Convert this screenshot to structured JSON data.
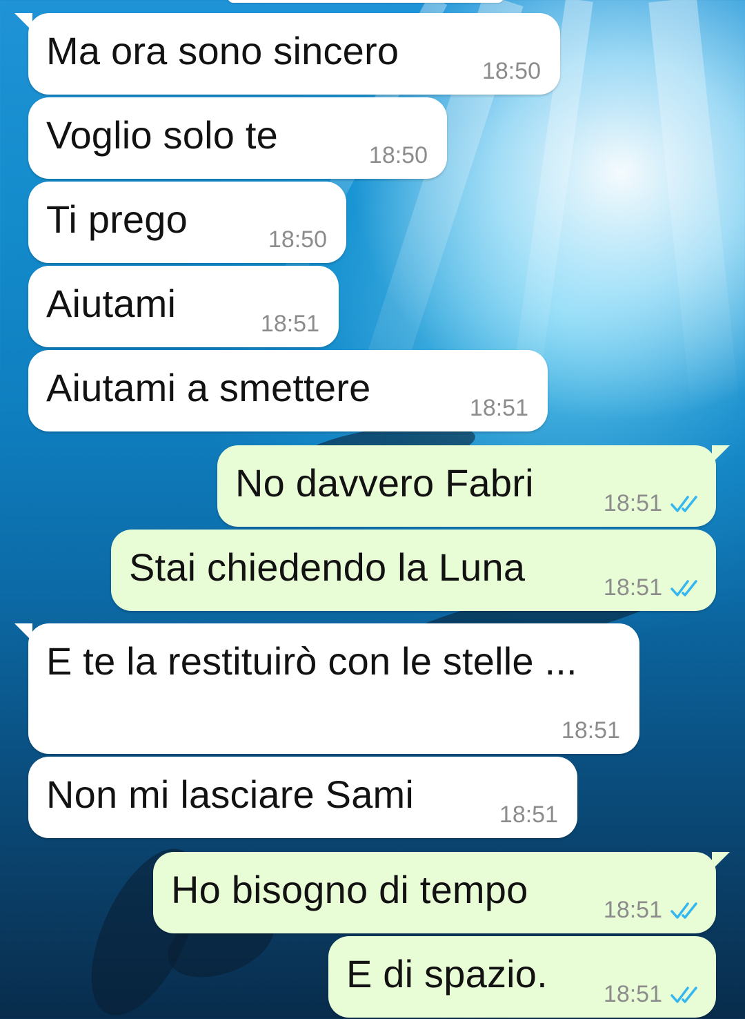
{
  "colors": {
    "incoming_bubble": "#ffffff",
    "outgoing_bubble": "#e8fcd6",
    "timestamp": "#8c8c8c",
    "read_ticks": "#34b7f1"
  },
  "messages": [
    {
      "direction": "incoming",
      "text": "Ma ora sono sincero",
      "time": "18:50"
    },
    {
      "direction": "incoming",
      "text": "Voglio solo te",
      "time": "18:50"
    },
    {
      "direction": "incoming",
      "text": "Ti prego",
      "time": "18:50"
    },
    {
      "direction": "incoming",
      "text": "Aiutami",
      "time": "18:51"
    },
    {
      "direction": "incoming",
      "text": "Aiutami a smettere",
      "time": "18:51"
    },
    {
      "direction": "outgoing",
      "text": "No davvero Fabri",
      "time": "18:51",
      "status_icon": "double-check-read-icon"
    },
    {
      "direction": "outgoing",
      "text": "Stai chiedendo la Luna",
      "time": "18:51",
      "status_icon": "double-check-read-icon"
    },
    {
      "direction": "incoming",
      "text": "E te la restituirò con le stelle ...",
      "time": "18:51"
    },
    {
      "direction": "incoming",
      "text": "Non mi lasciare Sami",
      "time": "18:51"
    },
    {
      "direction": "outgoing",
      "text": "Ho bisogno di tempo",
      "time": "18:51",
      "status_icon": "double-check-read-icon"
    },
    {
      "direction": "outgoing",
      "text": "E di spazio.",
      "time": "18:51",
      "status_icon": "double-check-read-icon"
    }
  ]
}
